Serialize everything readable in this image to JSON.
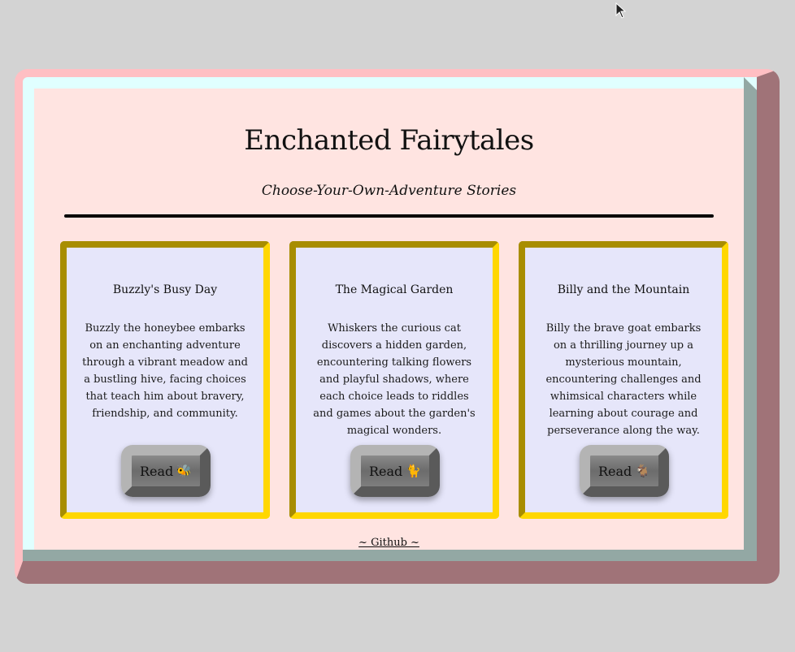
{
  "header": {
    "title": "Enchanted Fairytales",
    "subtitle": "Choose-Your-Own-Adventure Stories"
  },
  "stories": [
    {
      "title": "Buzzly's Busy Day",
      "description": "Buzzly the honeybee embarks on an enchanting adventure through a vibrant meadow and a bustling hive, facing choices that teach him about bravery, friendship, and community.",
      "button_label": "Read",
      "button_emoji": "🐝"
    },
    {
      "title": "The Magical Garden",
      "description": "Whiskers the curious cat discovers a hidden garden, encountering talking flowers and playful shadows, where each choice leads to riddles and games about the garden's magical wonders.",
      "button_label": "Read",
      "button_emoji": "🐈"
    },
    {
      "title": "Billy and the Mountain",
      "description": "Billy the brave goat embarks on a thrilling journey up a mysterious mountain, encountering challenges and whimsical characters while learning about courage and perseverance along the way.",
      "button_label": "Read",
      "button_emoji": "🐐"
    }
  ],
  "footer": {
    "link_label": "~ Github ~"
  },
  "colors": {
    "page_background": "#d3d3d3",
    "panel_background": "#ffe4e1",
    "card_background": "#e6e6fa",
    "card_border_light": "#ffd700",
    "card_border_dark": "#a88d00",
    "frame_pink": "#ffbfc3",
    "frame_cyan": "#e0ffff"
  },
  "icons": {
    "cursor": "mouse-pointer-icon"
  }
}
